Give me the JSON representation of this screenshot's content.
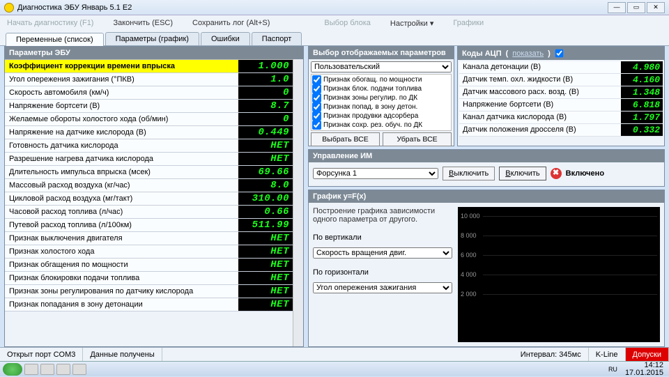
{
  "window": {
    "title": "Диагностика ЭБУ Январь 5.1 E2"
  },
  "menu": {
    "start": "Начать диагностику (F1)",
    "stop": "Закончить (ESC)",
    "savelog": "Сохранить лог (Alt+S)",
    "block": "Выбор блока",
    "settings": "Настройки",
    "charts": "Графики"
  },
  "tabs": {
    "vars": "Переменные (список)",
    "params": "Параметры (график)",
    "errors": "Ошибки",
    "passport": "Паспорт"
  },
  "ecu": {
    "header": "Параметры ЭБУ",
    "rows": [
      {
        "label": "Коэффициент коррекции времени впрыска",
        "value": "1.000",
        "hl": true
      },
      {
        "label": "Угол опережения зажигания (°ПКВ)",
        "value": "1.0"
      },
      {
        "label": "Скорость автомобиля (км/ч)",
        "value": "0"
      },
      {
        "label": "Напряжение бортсети (В)",
        "value": "8.7"
      },
      {
        "label": "Желаемые обороты холостого хода (об/мин)",
        "value": "0"
      },
      {
        "label": "Напряжение на датчике кислорода (В)",
        "value": "0.449"
      },
      {
        "label": "Готовность датчика кислорода",
        "value": "НЕТ"
      },
      {
        "label": "Разрешение нагрева датчика кислорода",
        "value": "НЕТ"
      },
      {
        "label": "Длительность импульса впрыска (мсек)",
        "value": "69.66"
      },
      {
        "label": "Массовый расход воздуха (кг/час)",
        "value": "8.0"
      },
      {
        "label": "Цикловой расход воздуха (мг/такт)",
        "value": "310.00"
      },
      {
        "label": "Часовой расход топлива (л/час)",
        "value": "0.66"
      },
      {
        "label": "Путевой расход топлива (л/100км)",
        "value": "511.99"
      },
      {
        "label": "Признак выключения двигателя",
        "value": "НЕТ"
      },
      {
        "label": "Признак холостого хода",
        "value": "НЕТ"
      },
      {
        "label": "Признак обгащения по мощности",
        "value": "НЕТ"
      },
      {
        "label": "Признак блокировки подачи топлива",
        "value": "НЕТ"
      },
      {
        "label": "Признак зоны регулирования по датчику кислорода",
        "value": "НЕТ"
      },
      {
        "label": "Признак попадания в зону детонации",
        "value": "НЕТ"
      }
    ]
  },
  "filter": {
    "header": "Выбор отображаемых параметров",
    "preset": "Пользовательский",
    "items": [
      "Признак обогащ. по мощности",
      "Признак блок. подачи топлива",
      "Признак зоны регулир. по ДК",
      "Признак попад. в зону детон.",
      "Признак продувки адсорбера",
      "Признак сохр. рез. обуч. по ДК"
    ],
    "select_all": "Выбрать ВСЕ",
    "clear_all": "Убрать ВСЕ"
  },
  "adc": {
    "header": "Коды АЦП",
    "show": "показать",
    "rows": [
      {
        "label": "Канала детонации (В)",
        "value": "4.980"
      },
      {
        "label": "Датчик темп. охл. жидкости (В)",
        "value": "4.160"
      },
      {
        "label": "Датчик массового расх. возд. (В)",
        "value": "1.348"
      },
      {
        "label": "Напряжение бортсети (В)",
        "value": "6.818"
      },
      {
        "label": "Канал датчика кислорода (В)",
        "value": "1.797"
      },
      {
        "label": "Датчик положения дросселя (В)",
        "value": "0.332"
      }
    ]
  },
  "ctrl": {
    "header": "Управление ИМ",
    "target": "Форсунка 1",
    "off": "Выключить",
    "on": "Включить",
    "state": "Включено"
  },
  "graph": {
    "header": "График y=F(x)",
    "desc": "Построение графика зависимости одного параметра от другого.",
    "ylabel": "По вертикали",
    "yparam": "Скорость вращения двиг.",
    "xlabel": "По горизонтали",
    "xparam": "Угол опережения зажигания",
    "ticks": [
      "10 000",
      "8 000",
      "6 000",
      "4 000",
      "2 000"
    ]
  },
  "status": {
    "port": "Открыт порт COM3",
    "data": "Данные получены",
    "interval": "Интервал: 345мс",
    "kline": "K-Line",
    "tol": "Допуски"
  },
  "taskbar": {
    "lang": "RU",
    "time": "14:12",
    "date": "17.01.2015"
  }
}
